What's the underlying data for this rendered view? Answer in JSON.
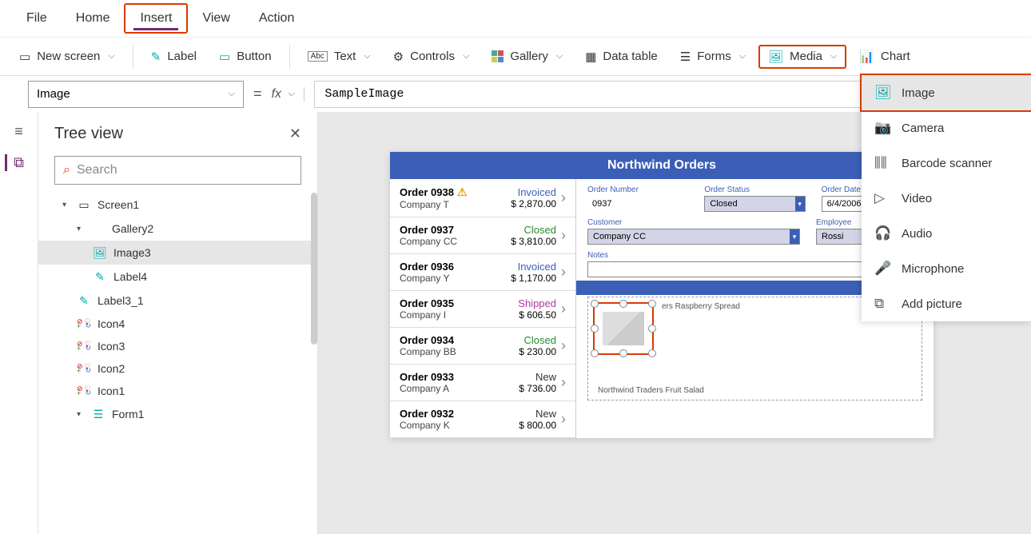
{
  "tabs": {
    "file": "File",
    "home": "Home",
    "insert": "Insert",
    "view": "View",
    "action": "Action"
  },
  "ribbon": {
    "new_screen": "New screen",
    "label": "Label",
    "button": "Button",
    "text": "Text",
    "controls": "Controls",
    "gallery": "Gallery",
    "data_table": "Data table",
    "forms": "Forms",
    "media": "Media",
    "chart": "Chart"
  },
  "formula": {
    "property": "Image",
    "fx": "fx",
    "value": "SampleImage",
    "equals": "="
  },
  "tree": {
    "title": "Tree view",
    "search_placeholder": "Search",
    "items": {
      "screen1": "Screen1",
      "gallery2": "Gallery2",
      "image3": "Image3",
      "label4": "Label4",
      "label3_1": "Label3_1",
      "icon4": "Icon4",
      "icon3": "Icon3",
      "icon2": "Icon2",
      "icon1": "Icon1",
      "form1": "Form1"
    }
  },
  "media_menu": {
    "image": "Image",
    "camera": "Camera",
    "barcode": "Barcode scanner",
    "video": "Video",
    "audio": "Audio",
    "microphone": "Microphone",
    "add_picture": "Add picture"
  },
  "app": {
    "title": "Northwind Orders",
    "orders": [
      {
        "num": "Order 0938",
        "warn": true,
        "company": "Company T",
        "status": "Invoiced",
        "st_class": "st-invoiced",
        "price": "$ 2,870.00"
      },
      {
        "num": "Order 0937",
        "warn": false,
        "company": "Company CC",
        "status": "Closed",
        "st_class": "st-closed",
        "price": "$ 3,810.00"
      },
      {
        "num": "Order 0936",
        "warn": false,
        "company": "Company Y",
        "status": "Invoiced",
        "st_class": "st-invoiced",
        "price": "$ 1,170.00"
      },
      {
        "num": "Order 0935",
        "warn": false,
        "company": "Company I",
        "status": "Shipped",
        "st_class": "st-shipped",
        "price": "$ 606.50"
      },
      {
        "num": "Order 0934",
        "warn": false,
        "company": "Company BB",
        "status": "Closed",
        "st_class": "st-closed",
        "price": "$ 230.00"
      },
      {
        "num": "Order 0933",
        "warn": false,
        "company": "Company A",
        "status": "New",
        "st_class": "st-new",
        "price": "$ 736.00"
      },
      {
        "num": "Order 0932",
        "warn": false,
        "company": "Company K",
        "status": "New",
        "st_class": "st-new",
        "price": "$ 800.00"
      }
    ],
    "detail": {
      "labels": {
        "order_number": "Order Number",
        "order_status": "Order Status",
        "order_date": "Order Date",
        "customer": "Customer",
        "employee": "Employee",
        "notes": "Notes"
      },
      "vals": {
        "order_number": "0937",
        "order_status": "Closed",
        "order_date": "6/4/2006",
        "customer": "Company CC",
        "employee": "Rossi",
        "notes": ""
      },
      "products": {
        "p1": "ers Raspberry Spread",
        "p2": "Northwind Traders Fruit Salad"
      }
    }
  }
}
